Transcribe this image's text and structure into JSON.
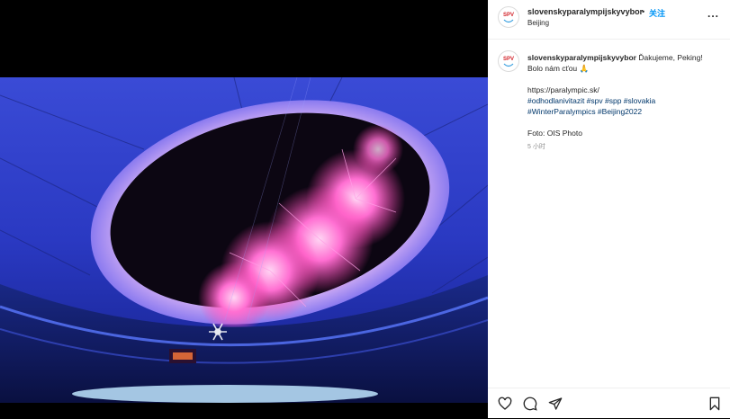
{
  "post": {
    "author": "slovenskyparalympijskyvybor",
    "separator": "•",
    "follow_label": "关注",
    "location": "Beijing",
    "more_label": "...",
    "caption": {
      "author": "slovenskyparalympijskyvybor",
      "text_line1": "Ďakujeme, Peking!",
      "text_line2": "Bolo nám cťou 🙏",
      "link": "https://paralympic.sk/",
      "hashtags_line1": "#odhodlanivitazit #spv #spp #slovakia",
      "hashtags_line2": "#WinterParalympics #Beijing2022",
      "credit": "Foto: OIS Photo"
    },
    "time": "5 小时"
  },
  "avatar": {
    "initials": "SPV",
    "color": "#d2232a"
  },
  "icons": {
    "like": "heart-icon",
    "comment": "comment-icon",
    "share": "share-icon",
    "save": "bookmark-icon",
    "more": "more-icon"
  }
}
